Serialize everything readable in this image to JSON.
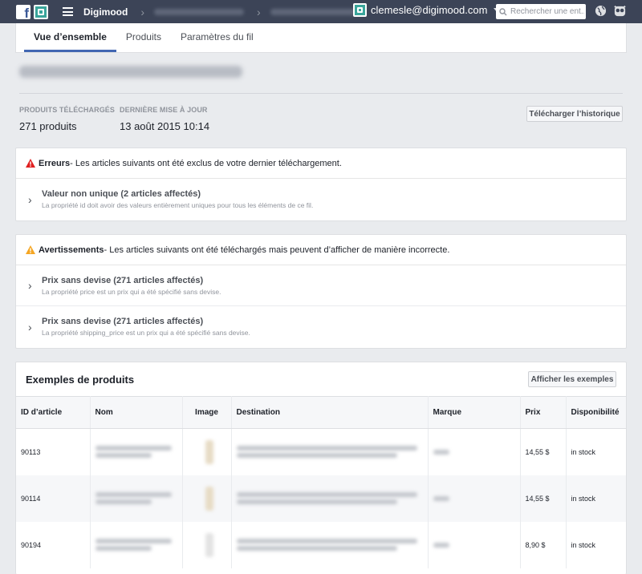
{
  "topbar": {
    "business_name": "Digimood",
    "account_email": "clemesle@digimood.com",
    "search_placeholder": "Rechercher une ent..."
  },
  "tabs": [
    {
      "label": "Vue d’ensemble",
      "active": true
    },
    {
      "label": "Produits",
      "active": false
    },
    {
      "label": "Paramètres du fil",
      "active": false
    }
  ],
  "stats": {
    "uploaded_label": "PRODUITS TÉLÉCHARGÉS",
    "uploaded_value": "271 produits",
    "updated_label": "DERNIÈRE MISE À JOUR",
    "updated_value": "13 août 2015 10:14",
    "history_button": "Télécharger l’historique"
  },
  "errors": {
    "title": "Erreurs",
    "description": " - Les articles suivants ont été exclus de votre dernier téléchargement.",
    "items": [
      {
        "title": "Valeur non unique (2 articles affectés)",
        "detail": "La propriété id doit avoir des valeurs entièrement uniques pour tous les éléments de ce fil."
      }
    ]
  },
  "warnings": {
    "title": "Avertissements",
    "description": " - Les articles suivants ont été téléchargés mais peuvent d’afficher de manière incorrecte.",
    "items": [
      {
        "title": "Prix sans devise (271 articles affectés)",
        "detail": "La propriété price est un prix qui a été spécifié sans devise."
      },
      {
        "title": "Prix sans devise (271 articles affectés)",
        "detail": "La propriété shipping_price est un prix qui a été spécifié sans devise."
      }
    ]
  },
  "samples": {
    "title": "Exemples de produits",
    "button": "Afficher les exemples",
    "columns": [
      "ID d’article",
      "Nom",
      "Image",
      "Destination",
      "Marque",
      "Prix",
      "Disponibilité"
    ],
    "rows": [
      {
        "id": "90113",
        "price": "14,55 $",
        "availability": "in stock"
      },
      {
        "id": "90114",
        "price": "14,55 $",
        "availability": "in stock"
      },
      {
        "id": "90194",
        "price": "8,90 $",
        "availability": "in stock"
      }
    ]
  },
  "colors": {
    "topbar": "#3c4457",
    "tab_active": "#4267b2",
    "error_icon": "#e02020",
    "warning_icon": "#f5a623"
  }
}
